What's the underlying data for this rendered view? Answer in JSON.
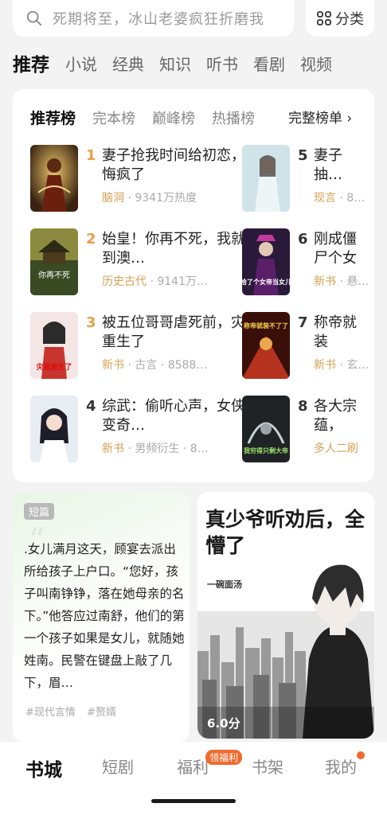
{
  "search": {
    "placeholder": "死期将至，冰山老婆疯狂折磨我",
    "category_label": "分类"
  },
  "tabs": [
    "推荐",
    "小说",
    "经典",
    "知识",
    "听书",
    "看剧",
    "视频"
  ],
  "ranking": {
    "tabs": [
      "推荐榜",
      "完本榜",
      "巅峰榜",
      "热播榜"
    ],
    "full_list_label": "完整榜单",
    "books": [
      {
        "rank": "1",
        "title": "妻子抢我时间给初恋，她悔疯了",
        "tag": "脑洞",
        "meta": " · 9341万热度"
      },
      {
        "rank": "2",
        "title": "始皇！你再不死，我就打到澳…",
        "tag": "历史古代",
        "meta": " · 9141万…"
      },
      {
        "rank": "3",
        "title": "被五位哥哥虐死前，灾星重生了",
        "tag": "新书",
        "meta": " · 古言 · 8588…"
      },
      {
        "rank": "4",
        "title": "综武：偷听心声，女侠们变奇…",
        "tag": "新书",
        "meta": " · 男频衍生 · 8…"
      },
      {
        "rank": "5",
        "title": "妻子抽…后，悔…",
        "tag": "现言",
        "meta": " · 8…"
      },
      {
        "rank": "6",
        "title": "刚成僵尸个女帝…",
        "tag": "新书",
        "meta": " · 悬…"
      },
      {
        "rank": "7",
        "title": "称帝就装了，…",
        "tag": "新书",
        "meta": " · 玄…"
      },
      {
        "rank": "8",
        "title": "各大宗蕴，我…",
        "tag": "多人二刷",
        "meta": ""
      }
    ],
    "cover_texts": {
      "b2": "你再不死",
      "b3": "灾星重生了",
      "b6": "拾了个女帝当女儿",
      "b7": "称帝就装不了了",
      "b8": "我穷得只剩大帝"
    }
  },
  "short_story": {
    "badge": "短篇",
    "text": ".女儿满月这天，顾宴去派出所给孩子上户口。“您好，孩子叫南铮铮，落在她母亲的名下。”他答应过南舒，他们的第一个孩子如果是女儿，就随她姓南。民警在键盘上敲了几下，眉…",
    "tags": [
      "#现代言情",
      "#赘婿"
    ]
  },
  "promo": {
    "title": "真少爷听劝后，全懵了",
    "subtitle": "一碗面汤",
    "rating": "6.0分"
  },
  "bottom_nav": {
    "items": [
      "书城",
      "短剧",
      "福利",
      "书架",
      "我的"
    ],
    "fuli_badge": "领福利"
  },
  "colors": {
    "accent": "#f06a2f",
    "gold_rank": "#e6a14a",
    "tag": "#d4a155"
  }
}
